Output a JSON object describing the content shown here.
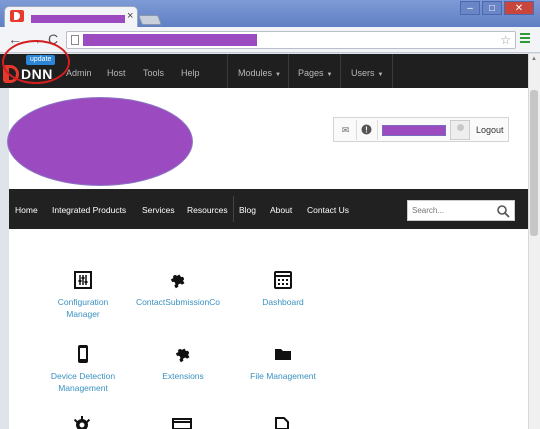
{
  "browser": {
    "tab_close": "×",
    "window_buttons": {
      "minimize": "–",
      "maximize": "□",
      "close": "✕"
    },
    "nav": {
      "back": "←",
      "forward": "→",
      "reload": "C"
    },
    "star": "☆"
  },
  "controlbar": {
    "logo_text": "DNN",
    "update_badge": "update",
    "items": [
      {
        "label": "Admin"
      },
      {
        "label": "Host"
      },
      {
        "label": "Tools"
      },
      {
        "label": "Help"
      }
    ],
    "menus": [
      {
        "label": "Modules",
        "caret": "▼"
      },
      {
        "label": "Pages",
        "caret": "▼"
      },
      {
        "label": "Users",
        "caret": "▼"
      }
    ]
  },
  "userbar": {
    "mail_icon": "✉",
    "notify_icon": "!",
    "logout": "Logout"
  },
  "mainnav": {
    "items": [
      "Home",
      "Integrated Products",
      "Services",
      "Resources",
      "Blog",
      "About",
      "Contact Us"
    ],
    "search_placeholder": "Search..."
  },
  "modules": [
    {
      "label": "Configuration\nManager",
      "icon": "sliders-icon"
    },
    {
      "label": "ContactSubmissionCo",
      "icon": "puzzle-icon"
    },
    {
      "label": "Dashboard",
      "icon": "dashboard-icon"
    },
    {
      "label": "Device Detection\nManagement",
      "icon": "mobile-icon"
    },
    {
      "label": "Extensions",
      "icon": "puzzle-icon"
    },
    {
      "label": "File Management",
      "icon": "folder-icon"
    }
  ],
  "colors": {
    "accent_link": "#3a91c1",
    "redacted": "#9b4bbf",
    "annotation": "#d21e1e",
    "dnn_red": "#e8372b"
  }
}
